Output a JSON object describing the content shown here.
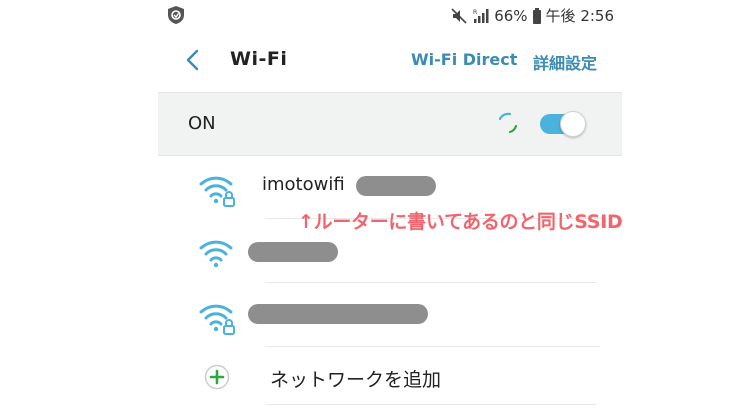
{
  "status_bar": {
    "battery": "66%",
    "time": "午後 2:56",
    "icons": [
      "shield-icon",
      "mute-icon",
      "signal-icon",
      "battery-icon"
    ]
  },
  "action_bar": {
    "title": "Wi-Fi",
    "wifi_direct_label": "Wi-Fi Direct",
    "advanced_label": "詳細設定"
  },
  "wifi_toggle": {
    "label": "ON",
    "state": "on"
  },
  "networks": [
    {
      "name": "imotowifi",
      "secured": true,
      "name_partially_redacted": true
    },
    {
      "name": "",
      "secured": false,
      "name_redacted": true
    },
    {
      "name": "",
      "secured": true,
      "name_redacted": true
    }
  ],
  "add_network": {
    "label": "ネットワークを追加"
  },
  "annotation": {
    "text": "↑ルーターに書いてあるのと同じSSID"
  },
  "colors": {
    "accent": "#3c8bb1",
    "wifi_icon": "#4ab3dd",
    "toggle_on": "#4ab3dd",
    "annotation": "#f0656e",
    "plus_green": "#2eaa3c",
    "redaction": "#8e8e8e"
  }
}
